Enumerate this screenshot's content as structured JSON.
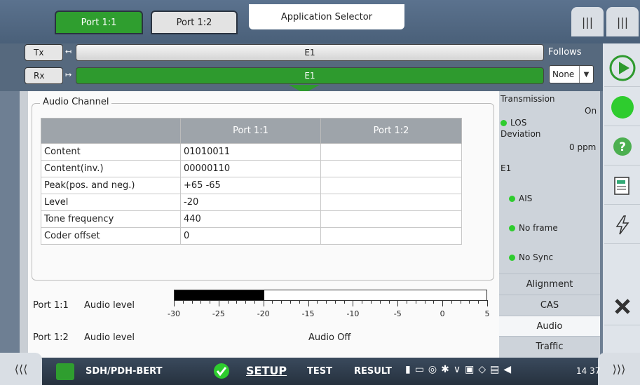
{
  "header": {
    "tabs": [
      {
        "label": "Port 1:1",
        "active": true
      },
      {
        "label": "Port 1:2",
        "active": false
      }
    ],
    "app_selector": "Application Selector"
  },
  "signal": {
    "tx_label": "Tx",
    "rx_label": "Rx",
    "tx_signal": "E1",
    "rx_signal": "E1",
    "follows_label": "Follows",
    "follows_value": "None"
  },
  "audio_channel": {
    "title": "Audio Channel",
    "columns": [
      "",
      "Port 1:1",
      "Port 1:2"
    ],
    "rows": [
      {
        "label": "Content",
        "p1": "01010011",
        "p2": ""
      },
      {
        "label": "Content(inv.)",
        "p1": "00000110",
        "p2": ""
      },
      {
        "label": "Peak(pos. and neg.)",
        "p1": "+65 -65",
        "p2": ""
      },
      {
        "label": "Level",
        "p1": "-20",
        "p2": ""
      },
      {
        "label": "Tone frequency",
        "p1": "440",
        "p2": ""
      },
      {
        "label": "Coder offset",
        "p1": "0",
        "p2": ""
      }
    ]
  },
  "audio_levels": {
    "port1_label": "Port 1:1",
    "port1_metric": "Audio level",
    "port1_level_db": -20,
    "scale_min": -30,
    "scale_max": 5,
    "scale_labels": [
      "-30",
      "-25",
      "-20",
      "-15",
      "-10",
      "-5",
      "0",
      "5"
    ],
    "port2_label": "Port 1:2",
    "port2_metric": "Audio level",
    "port2_value": "Audio Off"
  },
  "status": {
    "transmission_label": "Transmission",
    "transmission_value": "On",
    "los_label": "LOS",
    "deviation_label": "Deviation",
    "deviation_value": "0 ppm",
    "e1_label": "E1",
    "alarms": [
      "AIS",
      "No frame",
      "No Sync"
    ],
    "led_color": "#2ecc2e"
  },
  "nav": {
    "items": [
      "Alignment",
      "CAS",
      "Audio",
      "Traffic"
    ],
    "active": "Audio"
  },
  "bottom": {
    "app_name": "SDH/PDH-BERT",
    "setup": "SETUP",
    "test": "TEST",
    "result": "RESULT",
    "time": "14 37"
  }
}
